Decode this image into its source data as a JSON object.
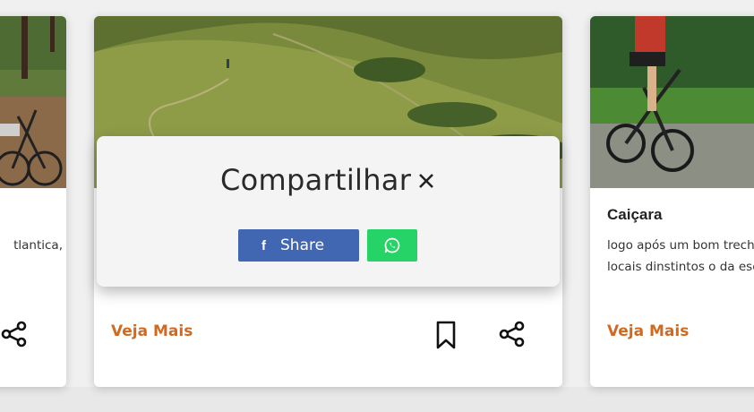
{
  "cards": {
    "left": {
      "text_line": "tlantica,"
    },
    "middle": {
      "veja_label": "Veja Mais"
    },
    "right": {
      "title": "Caiçara",
      "text_lines": [
        "logo após um bom trech",
        "locais dinstintos o da esc"
      ],
      "veja_label": "Veja Mais"
    }
  },
  "share_popup": {
    "title": "Compartilhar",
    "close_glyph": "×",
    "facebook_icon": "f",
    "facebook_label": "Share",
    "whatsapp_icon": "whatsapp-icon"
  },
  "colors": {
    "accent": "#d2691e",
    "facebook": "#4267b2",
    "whatsapp": "#25d366"
  }
}
